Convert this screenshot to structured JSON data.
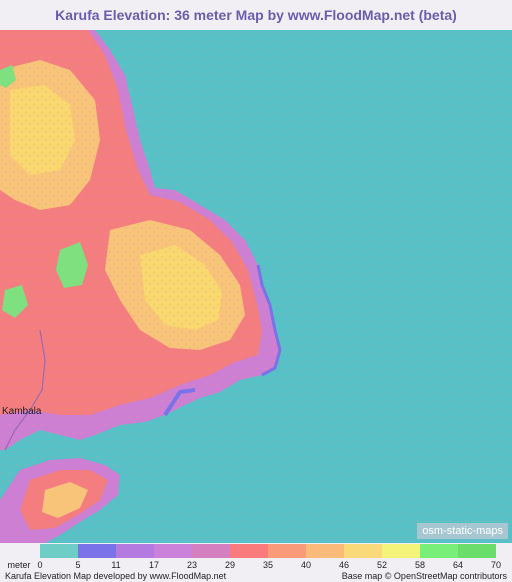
{
  "title": "Karufa Elevation: 36 meter Map by www.FloodMap.net (beta)",
  "map": {
    "place_label": "Kambala",
    "attribution_badge": "osm-static-maps",
    "sea_color": "#56c1c6",
    "low_color": "#c87bd0",
    "mid_color": "#f57a7a",
    "high_color": "#f9d36d"
  },
  "legend": {
    "unit_label": "meter",
    "ticks": [
      "0",
      "5",
      "11",
      "17",
      "23",
      "29",
      "35",
      "40",
      "46",
      "52",
      "58",
      "64",
      "70"
    ],
    "colors": [
      "#6ecdc4",
      "#7a72e8",
      "#b57adf",
      "#cb80da",
      "#d47fc0",
      "#f97b7b",
      "#f99b7a",
      "#f9ba7a",
      "#f9d979",
      "#f4f47a",
      "#78ef78",
      "#6bdd6b"
    ]
  },
  "footer": {
    "left": "Karufa Elevation Map developed by www.FloodMap.net",
    "right": "Base map © OpenStreetMap contributors"
  }
}
